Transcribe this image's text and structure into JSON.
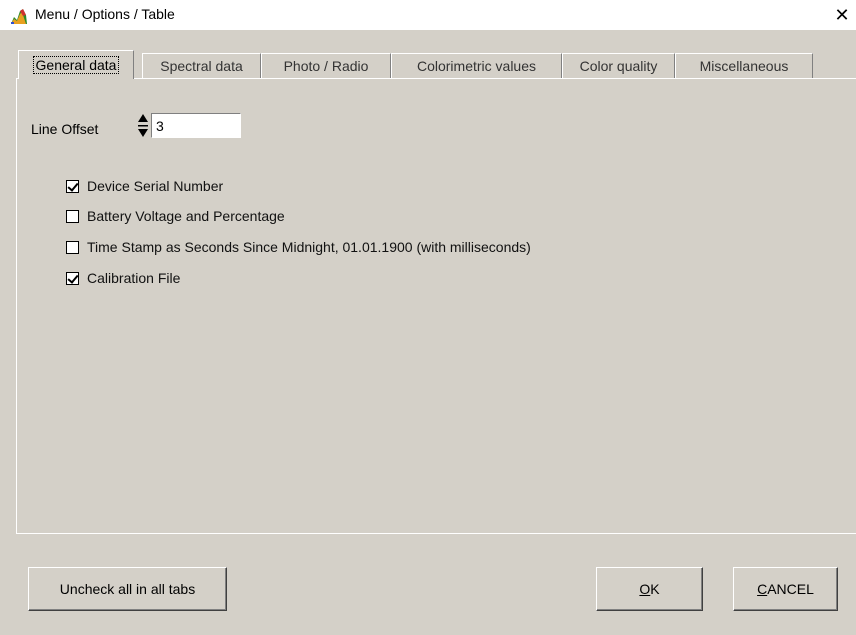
{
  "window": {
    "title": "Menu / Options / Table",
    "close_glyph": "✕"
  },
  "tabs": [
    {
      "label": "General data",
      "active": true
    },
    {
      "label": "Spectral data",
      "active": false
    },
    {
      "label": "Photo / Radio",
      "active": false
    },
    {
      "label": "Colorimetric values",
      "active": false
    },
    {
      "label": "Color quality",
      "active": false
    },
    {
      "label": "Miscellaneous",
      "active": false
    }
  ],
  "line_offset": {
    "label": "Line Offset",
    "value": "3"
  },
  "options": [
    {
      "label": "Device Serial Number",
      "checked": true
    },
    {
      "label": "Battery Voltage and Percentage",
      "checked": false
    },
    {
      "label": "Time Stamp as Seconds Since Midnight, 01.01.1900 (with milliseconds)",
      "checked": false
    },
    {
      "label": "Calibration File",
      "checked": true
    }
  ],
  "buttons": {
    "uncheck_all": "Uncheck all in all tabs",
    "ok_mnemonic": "O",
    "ok_rest": "K",
    "cancel_mnemonic": "C",
    "cancel_rest": "ANCEL"
  },
  "icons": {
    "app": "spectrum-chart-icon",
    "spinner": "up-down-arrows-icon"
  }
}
